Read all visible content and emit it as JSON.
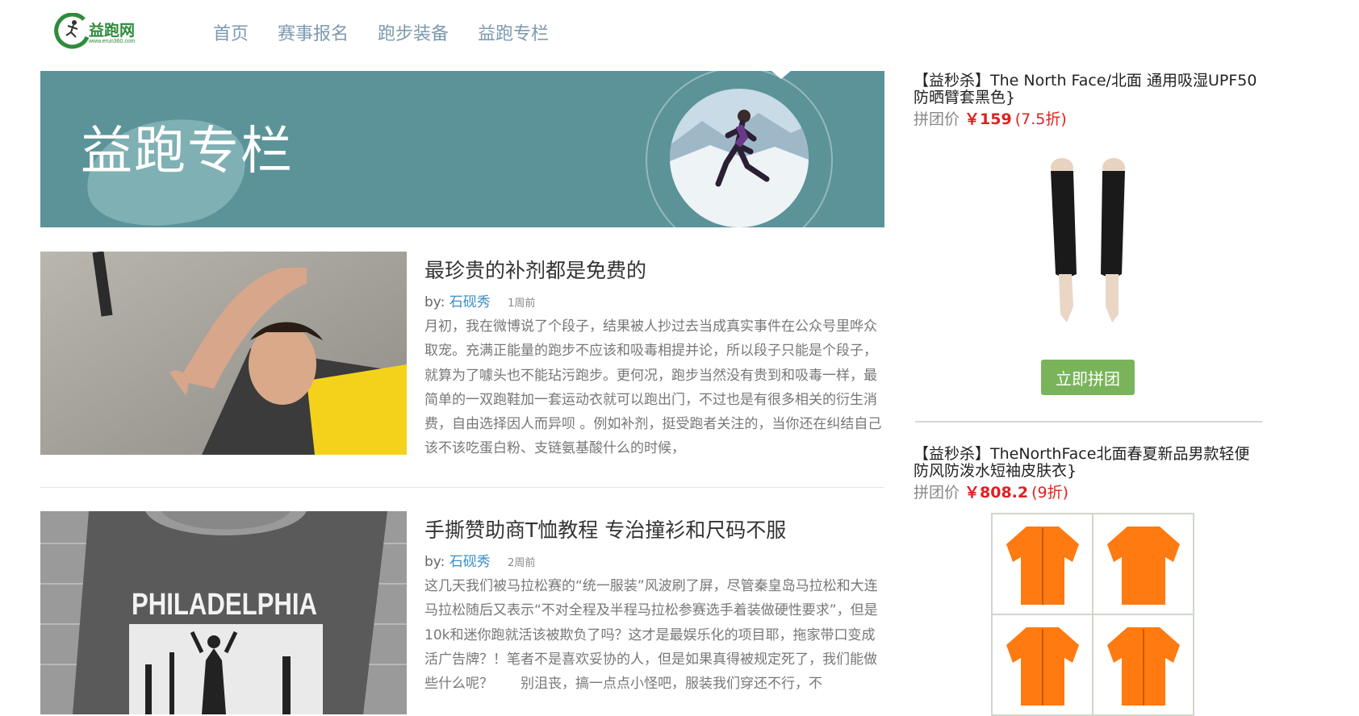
{
  "brand": {
    "name": "益跑网",
    "url": "www.erun360.com"
  },
  "nav": {
    "items": [
      "首页",
      "赛事报名",
      "跑步装备",
      "益跑专栏"
    ]
  },
  "banner": {
    "title": "益跑专栏"
  },
  "articles": [
    {
      "title": "最珍贵的补剂都是免费的",
      "by": "by:",
      "author": "石砚秀",
      "time": "1周前",
      "excerpt": "月初，我在微博说了个段子，结果被人抄过去当成真实事件在公众号里哗众取宠。充满正能量的跑步不应该和吸毒相提并论，所以段子只能是个段子，就算为了噱头也不能玷污跑步。更何况，跑步当然没有贵到和吸毒一样，最简单的一双跑鞋加一套运动衣就可以跑出门，不过也是有很多相关的衍生消费，自由选择因人而异呗 。例如补剂，挺受跑者关注的，当你还在纠结自己该不该吃蛋白粉、支链氨基酸什么的时候，"
    },
    {
      "title": "手撕赞助商T恤教程 专治撞衫和尺码不服",
      "by": "by:",
      "author": "石砚秀",
      "time": "2周前",
      "excerpt": "这几天我们被马拉松赛的“统一服装”风波刷了屏，尽管秦皇岛马拉松和大连马拉松随后又表示“不对全程及半程马拉松参赛选手着装做硬性要求”，但是10k和迷你跑就活该被欺负了吗？这才是最娱乐化的项目耶，拖家带口变成活广告牌？！笔者不是喜欢妥协的人，但是如果真得被规定死了，我们能做些什么呢？　　别沮丧，搞一点点小怪吧，服装我们穿还不行，不",
      "image_text": "PHILADELPHIA"
    }
  ],
  "sidebar": {
    "products": [
      {
        "title": "【益秒杀】The North Face/北面 通用吸湿UPF50防晒臂套黑色}",
        "price_label": "拼团价",
        "price": "￥159",
        "discount": "(7.5折)",
        "button": "立即拼团"
      },
      {
        "title": "【益秒杀】TheNorthFace北面春夏新品男款轻便防风防泼水短袖皮肤衣}",
        "price_label": "拼团价",
        "price": "￥808.2",
        "discount": "(9折)"
      }
    ]
  },
  "colors": {
    "banner": "#5b9399",
    "nav": "#7c9ab0",
    "link": "#3a8ec8",
    "price": "#e02020",
    "button": "#79b45a",
    "jacket": "#ff7a10"
  }
}
